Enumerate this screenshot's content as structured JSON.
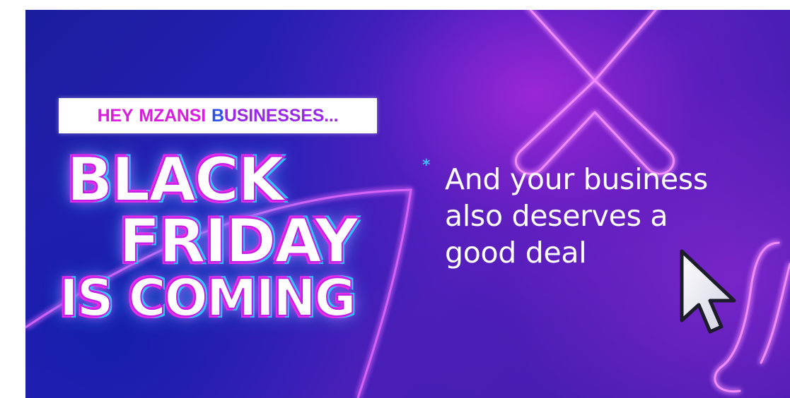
{
  "tagline": {
    "word_hey": "HEY",
    "word_mzansi": "MZANSI",
    "letter_b": "B",
    "rest": "USINESSES..."
  },
  "headline": {
    "line1": "BLACK",
    "line2": "FRIDAY",
    "line3": "IS COMING"
  },
  "message": {
    "asterisk": "*",
    "line1": "And your business",
    "line2": "also deserves a",
    "line3": "good deal"
  },
  "icons": {
    "cursor": "mouse-pointer-icon",
    "x_shape": "neon-x-icon"
  },
  "colors": {
    "magenta": "#d91ee0",
    "blue": "#2c52ea",
    "purple": "#9a28e8",
    "cyan_glow": "#2fc3ff",
    "background_dark": "#1a1d9e"
  }
}
